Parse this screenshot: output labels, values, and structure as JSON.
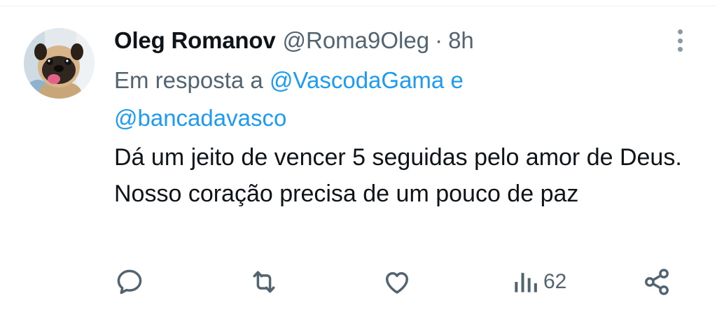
{
  "tweet": {
    "author_name": "Oleg Romanov",
    "handle": "@Roma9Oleg",
    "separator": "·",
    "time": "8h",
    "reply_prefix": "Em resposta a",
    "mention_1": "@VascodaGama",
    "reply_conjunction": "e",
    "mention_2": "@bancadavasco",
    "text": "Dá um jeito de vencer 5 seguidas pelo amor de Deus. Nosso coração precisa de um pouco de paz"
  },
  "actions": {
    "reply_icon": "comment-icon",
    "retweet_icon": "retweet-icon",
    "like_icon": "heart-icon",
    "views_icon": "views-bar-chart-icon",
    "views_count": "62",
    "share_icon": "share-icon"
  },
  "colors": {
    "text": "#0f1419",
    "secondary": "#536471",
    "link": "#1d9bf0",
    "menu_dots": "#8b98a5"
  }
}
